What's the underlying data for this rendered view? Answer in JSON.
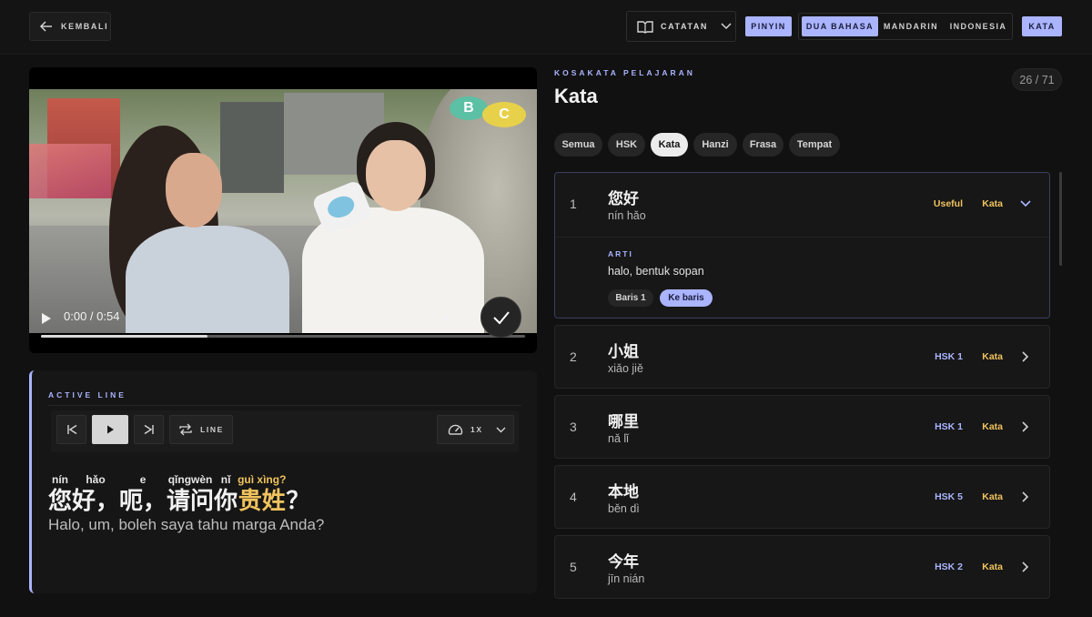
{
  "header": {
    "back_label": "KEMBALI",
    "notes_label": "CATATAN",
    "toggles": [
      {
        "label": "PINYIN",
        "active": true
      },
      {
        "label": "DUA BAHASA",
        "active": true
      },
      {
        "label": "MANDARIN",
        "active": false
      },
      {
        "label": "INDONESIA",
        "active": false
      },
      {
        "label": "KATA",
        "active": true
      }
    ]
  },
  "video": {
    "time": "0:00 / 0:54",
    "progress": 0.344,
    "overlay_letters": [
      "B",
      "C"
    ]
  },
  "active_line": {
    "label": "ACTIVE LINE",
    "loop_label": "LINE",
    "speed_label": "1X",
    "tokens": [
      {
        "pinyin": "nín",
        "hanzi": "您",
        "highlight": false
      },
      {
        "pinyin": "hǎo",
        "hanzi": "好，",
        "highlight": false
      },
      {
        "pinyin": "e",
        "hanzi": "呃，",
        "highlight": false
      },
      {
        "pinyin": "qǐngwèn",
        "hanzi": "请问",
        "highlight": false
      },
      {
        "pinyin": "nǐ",
        "hanzi": "你",
        "highlight": false
      },
      {
        "pinyin": "guì xìng?",
        "hanzi": "贵姓",
        "highlight": true
      },
      {
        "pinyin": "",
        "hanzi": "？",
        "highlight": false
      }
    ],
    "translation": "Halo, um, boleh saya tahu marga Anda?"
  },
  "vocab": {
    "eyebrow": "KOSAKATA PELAJARAN",
    "title": "Kata",
    "counter": "26 / 71",
    "filters": [
      {
        "label": "Semua",
        "active": false
      },
      {
        "label": "HSK",
        "active": false
      },
      {
        "label": "Kata",
        "active": true
      },
      {
        "label": "Hanzi",
        "active": false
      },
      {
        "label": "Frasa",
        "active": false
      },
      {
        "label": "Tempat",
        "active": false
      }
    ],
    "items": [
      {
        "num": "1",
        "hanzi": "您好",
        "pinyin": "nín hǎo",
        "level": "Useful",
        "type": "Kata",
        "expanded": true,
        "meaning_label": "ARTI",
        "meaning": "halo, bentuk sopan",
        "line_chip": "Baris 1",
        "goto_chip": "Ke baris"
      },
      {
        "num": "2",
        "hanzi": "小姐",
        "pinyin": "xiǎo jiě",
        "level": "HSK 1",
        "type": "Kata",
        "expanded": false
      },
      {
        "num": "3",
        "hanzi": "哪里",
        "pinyin": "nǎ lǐ",
        "level": "HSK 1",
        "type": "Kata",
        "expanded": false
      },
      {
        "num": "4",
        "hanzi": "本地",
        "pinyin": "běn dì",
        "level": "HSK 5",
        "type": "Kata",
        "expanded": false
      },
      {
        "num": "5",
        "hanzi": "今年",
        "pinyin": "jīn nián",
        "level": "HSK 2",
        "type": "Kata",
        "expanded": false
      }
    ]
  },
  "colors": {
    "accent": "#aab4ff",
    "highlight": "#f0c35e",
    "background": "#111111"
  }
}
